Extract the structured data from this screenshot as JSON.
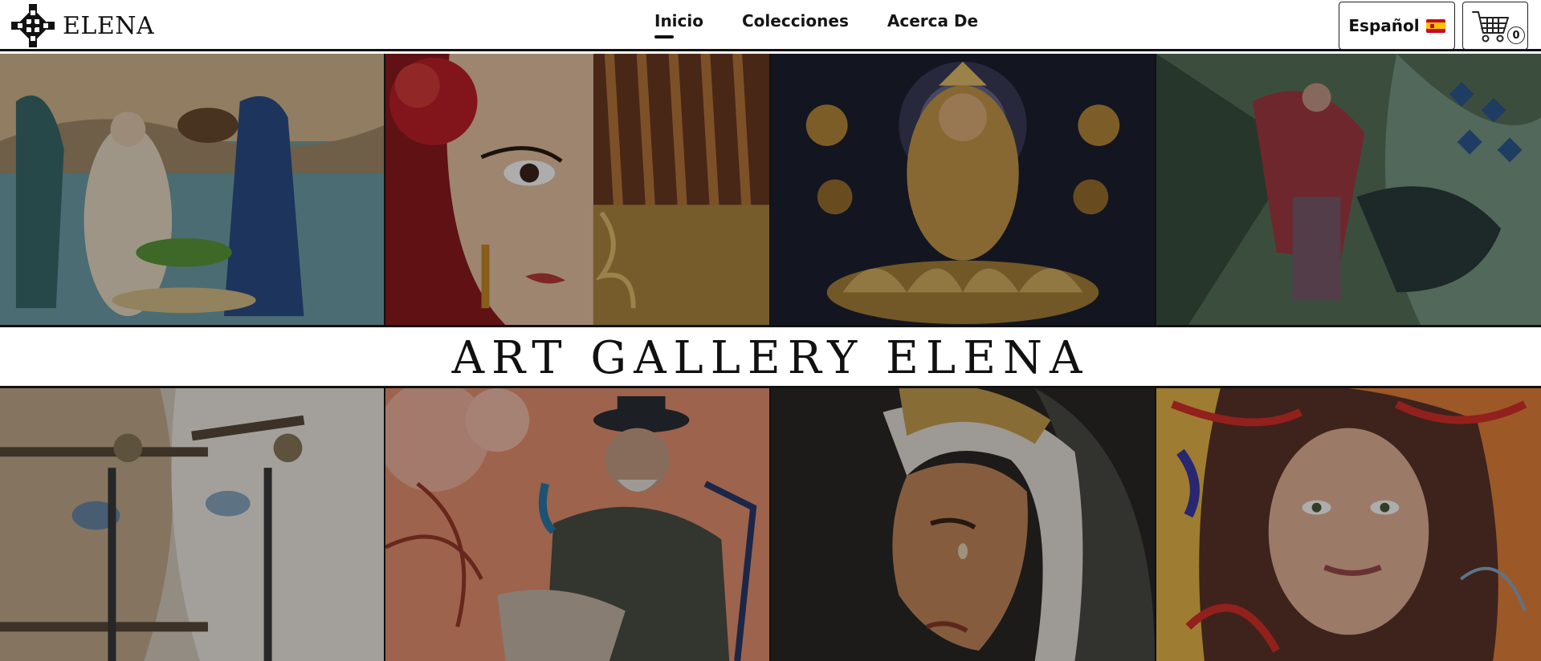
{
  "brand": {
    "name": "ELENA",
    "logo_icon": "ornament-cross-icon"
  },
  "nav": {
    "items": [
      {
        "label": "Inicio",
        "active": true
      },
      {
        "label": "Colecciones",
        "active": false
      },
      {
        "label": "Acerca De",
        "active": false
      }
    ]
  },
  "language": {
    "label": "Español",
    "flag_icon": "spain-flag-icon"
  },
  "cart": {
    "icon": "shopping-cart-icon",
    "count": "0"
  },
  "hero": {
    "title": "ART GALLERY ELENA"
  },
  "gallery": {
    "top_row": [
      {
        "subject": "woman-with-peacocks-painting",
        "palette": [
          "#6c8a7e",
          "#c9b49a",
          "#2f4f7a",
          "#8aa0b2"
        ]
      },
      {
        "subject": "woman-with-fan-painting",
        "palette": [
          "#9c1d1d",
          "#e8c2a8",
          "#3a2a20",
          "#b08850"
        ]
      },
      {
        "subject": "lakshmi-golden-painting",
        "palette": [
          "#1b1e2e",
          "#c7a25a",
          "#7a5a2a",
          "#e3c57a"
        ]
      },
      {
        "subject": "bullfighter-abstract-painting",
        "palette": [
          "#4e6b4a",
          "#2a3a2c",
          "#7c9a8a",
          "#345a8a"
        ]
      }
    ],
    "bottom_row": [
      {
        "subject": "horses-portrait-painting",
        "palette": [
          "#cfc5b6",
          "#8a7a66",
          "#3a3a3a",
          "#efe9e0"
        ]
      },
      {
        "subject": "man-in-hat-painting",
        "palette": [
          "#e58a6a",
          "#4a4a44",
          "#f3b28e",
          "#2d2d2d"
        ]
      },
      {
        "subject": "virgin-in-tears-painting",
        "palette": [
          "#2a2a2a",
          "#d8c2a0",
          "#a67a4a",
          "#e7e2d8"
        ]
      },
      {
        "subject": "woman-portrait-colorful-painting",
        "palette": [
          "#e8703a",
          "#f2c24a",
          "#b8462a",
          "#5a4a8a"
        ]
      }
    ]
  }
}
